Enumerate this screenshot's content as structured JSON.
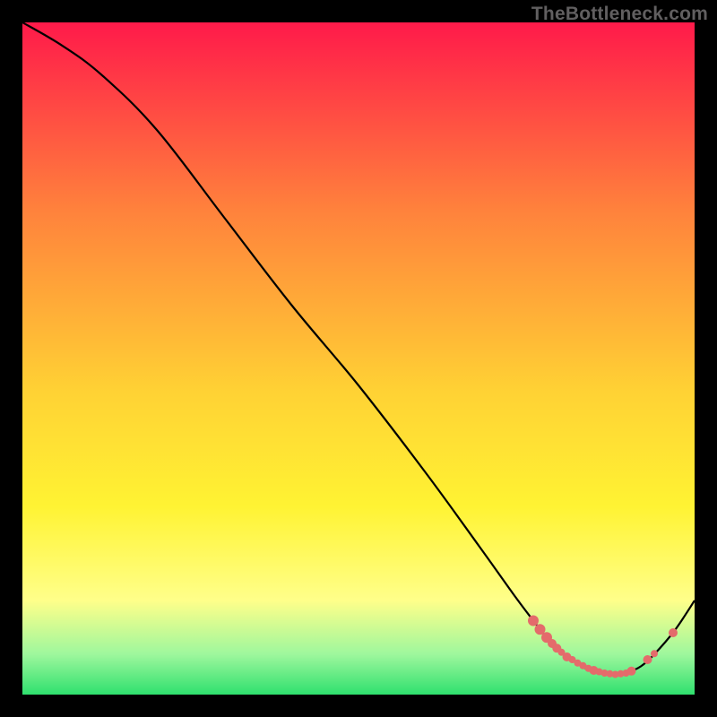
{
  "watermark": "TheBottleneck.com",
  "colors": {
    "bg": "#000000",
    "curve": "#000000",
    "dot": "#e46b6b",
    "grad_top": "#ff1a4a",
    "grad_mid_upper": "#ff823c",
    "grad_mid": "#ffd234",
    "grad_mid_lower": "#fff333",
    "grad_yellow_light": "#ffff8a",
    "grad_green_light": "#9ef79d",
    "grad_green": "#2fe06e"
  },
  "chart_data": {
    "type": "line",
    "title": "",
    "xlabel": "",
    "ylabel": "",
    "xlim": [
      0,
      100
    ],
    "ylim": [
      0,
      100
    ],
    "series": [
      {
        "name": "bottleneck-curve",
        "x": [
          0,
          6,
          12,
          20,
          30,
          40,
          50,
          60,
          68,
          73,
          76,
          78,
          80,
          82,
          84,
          86,
          88,
          90,
          92,
          94,
          97,
          100
        ],
        "y": [
          100,
          96.5,
          92,
          84,
          71,
          58,
          46,
          33,
          22,
          15,
          11,
          8.5,
          6.5,
          5.0,
          3.8,
          3.2,
          3.0,
          3.3,
          4.2,
          6.0,
          9.5,
          14
        ]
      }
    ],
    "markers": {
      "name": "highlight-dots",
      "points": [
        {
          "x": 76.0,
          "y": 11.0,
          "r": 6
        },
        {
          "x": 77.0,
          "y": 9.7,
          "r": 6
        },
        {
          "x": 78.0,
          "y": 8.5,
          "r": 6
        },
        {
          "x": 78.8,
          "y": 7.6,
          "r": 5
        },
        {
          "x": 79.5,
          "y": 6.9,
          "r": 5
        },
        {
          "x": 80.2,
          "y": 6.3,
          "r": 4
        },
        {
          "x": 81.0,
          "y": 5.6,
          "r": 5
        },
        {
          "x": 81.8,
          "y": 5.2,
          "r": 4
        },
        {
          "x": 82.6,
          "y": 4.7,
          "r": 4
        },
        {
          "x": 83.4,
          "y": 4.3,
          "r": 4
        },
        {
          "x": 84.2,
          "y": 3.9,
          "r": 4
        },
        {
          "x": 85.0,
          "y": 3.6,
          "r": 5
        },
        {
          "x": 85.8,
          "y": 3.4,
          "r": 4
        },
        {
          "x": 86.6,
          "y": 3.2,
          "r": 4
        },
        {
          "x": 87.4,
          "y": 3.1,
          "r": 4
        },
        {
          "x": 88.2,
          "y": 3.0,
          "r": 4
        },
        {
          "x": 89.0,
          "y": 3.1,
          "r": 4
        },
        {
          "x": 89.8,
          "y": 3.2,
          "r": 4
        },
        {
          "x": 90.6,
          "y": 3.5,
          "r": 5
        },
        {
          "x": 93.0,
          "y": 5.2,
          "r": 5
        },
        {
          "x": 94.0,
          "y": 6.1,
          "r": 4
        },
        {
          "x": 96.8,
          "y": 9.2,
          "r": 5
        }
      ]
    }
  }
}
